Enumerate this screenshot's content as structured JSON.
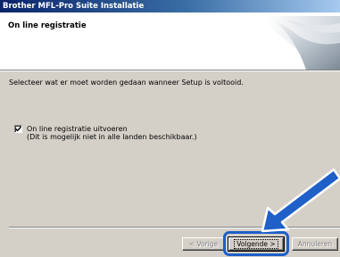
{
  "window": {
    "title": "Brother MFL-Pro Suite Installatie"
  },
  "header": {
    "title": "On line registratie"
  },
  "main": {
    "instruction": "Selecteer wat er moet worden gedaan wanneer Setup is voltooid.",
    "option": {
      "checked": true,
      "label": "On line registratie uitvoeren",
      "note": "(Dit is mogelijk niet in alle landen beschikbaar.)"
    }
  },
  "footer": {
    "back_label": "< Vorige",
    "next_label": "Volgende >",
    "cancel_label": "Annuleren"
  },
  "colors": {
    "highlight": "#1e5fc8",
    "titlebar": "#0a246a"
  }
}
